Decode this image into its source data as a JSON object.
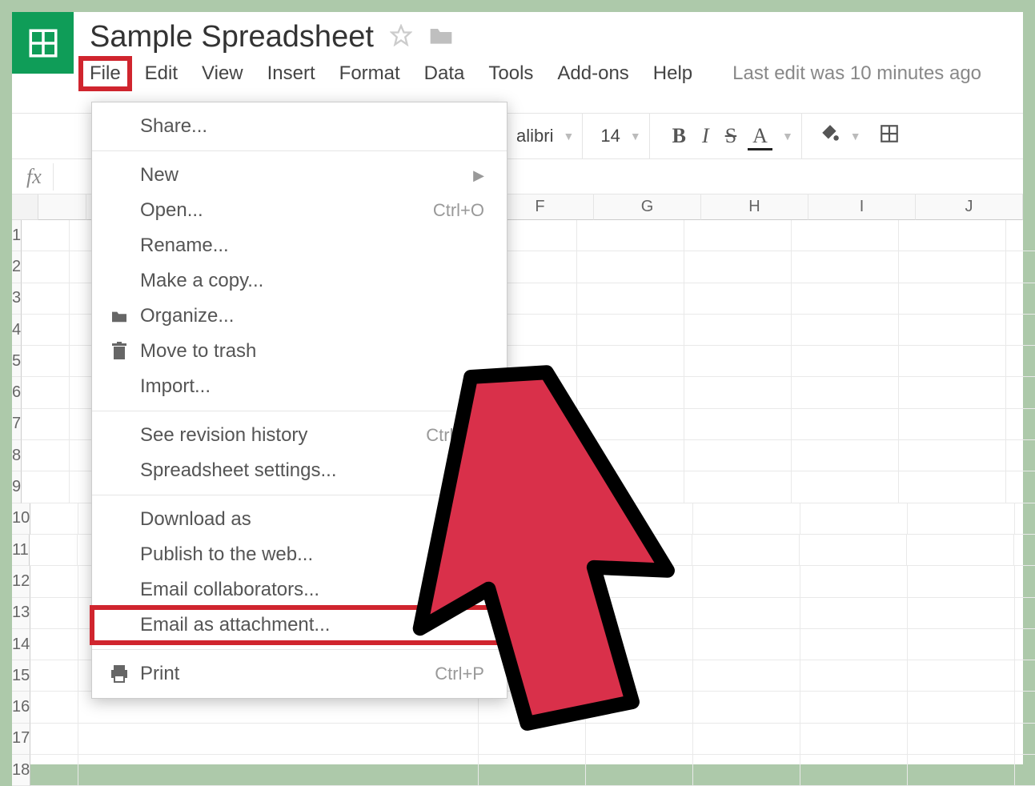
{
  "doc": {
    "title": "Sample Spreadsheet"
  },
  "menu": {
    "file": "File",
    "edit": "Edit",
    "view": "View",
    "insert": "Insert",
    "format": "Format",
    "data": "Data",
    "tools": "Tools",
    "addons": "Add-ons",
    "help": "Help",
    "last_edit": "Last edit was 10 minutes ago"
  },
  "toolbar": {
    "font_name": "alibri",
    "font_size": "14",
    "bold": "B",
    "italic": "I",
    "strike": "S",
    "text_a": "A"
  },
  "fx": {
    "label": "fx"
  },
  "columns": [
    "F",
    "G",
    "H",
    "I",
    "J"
  ],
  "rows": [
    "1",
    "2",
    "3",
    "4",
    "5",
    "6",
    "7",
    "8",
    "9",
    "10",
    "11",
    "12",
    "13",
    "14",
    "15",
    "16",
    "17",
    "18"
  ],
  "file_menu": {
    "share": "Share...",
    "new": "New",
    "open": "Open...",
    "open_sc": "Ctrl+O",
    "rename": "Rename...",
    "make_copy": "Make a copy...",
    "organize": "Organize...",
    "move_trash": "Move to trash",
    "import": "Import...",
    "revision": "See revision history",
    "revision_sc": "Ctrl+Alt",
    "settings": "Spreadsheet settings...",
    "download": "Download as",
    "publish": "Publish to the web...",
    "email_collab": "Email collaborators...",
    "email_attach": "Email as attachment...",
    "print": "Print",
    "print_sc": "Ctrl+P"
  }
}
